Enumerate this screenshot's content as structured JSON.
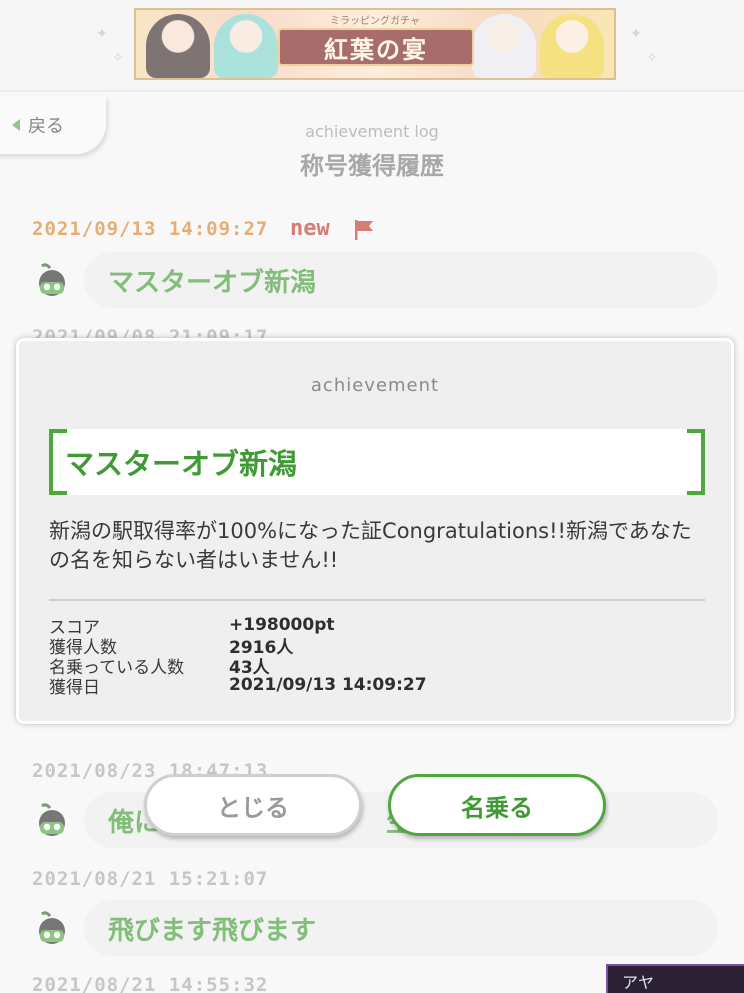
{
  "banner": {
    "kicker": "ミラッピングガチャ",
    "title": "紅葉の宴"
  },
  "nav": {
    "back_label": "戻る"
  },
  "page": {
    "subtitle": "achievement log",
    "title": "称号獲得履歴"
  },
  "log": {
    "new_label": "new",
    "entries": [
      {
        "date": "2021/09/13 14:09:27",
        "title": "マスターオブ新潟",
        "is_new": true
      },
      {
        "date": "2021/09/08 21:09:17",
        "title": ""
      },
      {
        "date": "2021/08/23 18:47:13",
        "title": "俺に"
      },
      {
        "date": "2021/08/21 15:21:07",
        "title": "飛びます飛びます"
      },
      {
        "date": "2021/08/21 14:55:32",
        "title": ""
      }
    ],
    "partial_suffix": "生"
  },
  "dialog": {
    "caption": "achievement",
    "title": "マスターオブ新潟",
    "description": "新潟の駅取得率が100%になった証Congratulations!!新潟であなたの名を知らない者はいません!!",
    "stats": [
      {
        "label": "スコア",
        "value": "+198000pt"
      },
      {
        "label": "獲得人数",
        "value": "2916人"
      },
      {
        "label": "名乗っている人数",
        "value": "43人"
      },
      {
        "label": "獲得日",
        "value": "2021/09/13 14:09:27"
      }
    ]
  },
  "buttons": {
    "close_label": "とじる",
    "claim_label": "名乗る"
  },
  "corner_tag": "アヤ",
  "colors": {
    "accent_green": "#4fa83e",
    "new_orange": "#d9822b",
    "new_red": "#c0392b"
  },
  "icons": [
    "back-triangle-icon",
    "new-flag-icon",
    "achievement-badge-icon"
  ]
}
